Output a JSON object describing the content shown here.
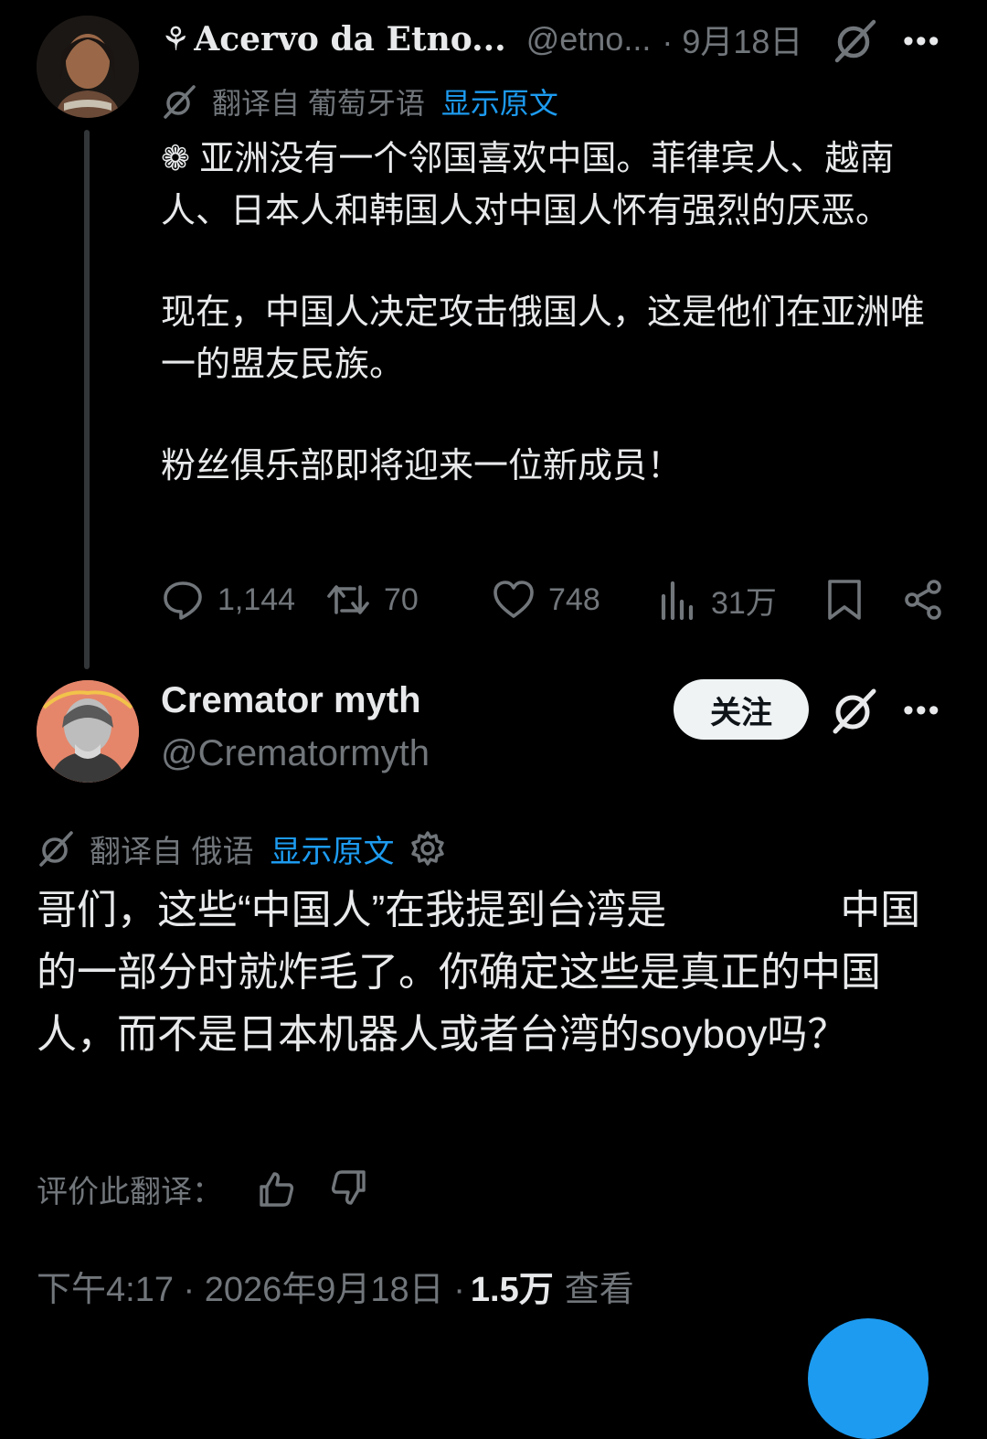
{
  "tweet1": {
    "author_name": "Acervo da Etno...",
    "handle": "@etno...",
    "date": "· 9月18日",
    "translation_label": "翻译自 葡萄牙语",
    "show_original": "显示原文",
    "paragraphs": [
      "❁ 亚洲没有一个邻国喜欢中国。菲律宾人、越南人、日本人和韩国人对中国人怀有强烈的厌恶。",
      "现在，中国人决定攻击俄国人，这是他们在亚洲唯一的盟友民族。",
      "粉丝俱乐部即将迎来一位新成员！"
    ],
    "stats": {
      "replies": "1,144",
      "reposts": "70",
      "likes": "748",
      "views": "31万"
    }
  },
  "tweet2": {
    "author_name": "Cremator myth",
    "handle": "@Cremator​myth",
    "follow_label": "关注",
    "translation_label": "翻译自 俄语",
    "show_original": "显示原文",
    "text_part1": "哥们，这些“中国人”在我提到台湾是",
    "text_part2": "中国的一部分时就炸毛了。你确定这些是真正的中国人，而不是日本机器人或者台湾的soyboy吗？",
    "rate_label": "评价此翻译：",
    "timestamp": "下午4:17 · 2026年9月18日 ·",
    "views_count": "1.5万",
    "views_label": "查看"
  },
  "colors": {
    "background": "#000000",
    "text": "#e7e9ea",
    "secondary": "#71767b",
    "accent": "#1d9bf0"
  },
  "icons": [
    "grok-icon",
    "more-icon",
    "reply-icon",
    "repost-icon",
    "like-icon",
    "views-icon",
    "bookmark-icon",
    "share-icon",
    "gear-icon",
    "thumbs-up-icon",
    "thumbs-down-icon"
  ]
}
